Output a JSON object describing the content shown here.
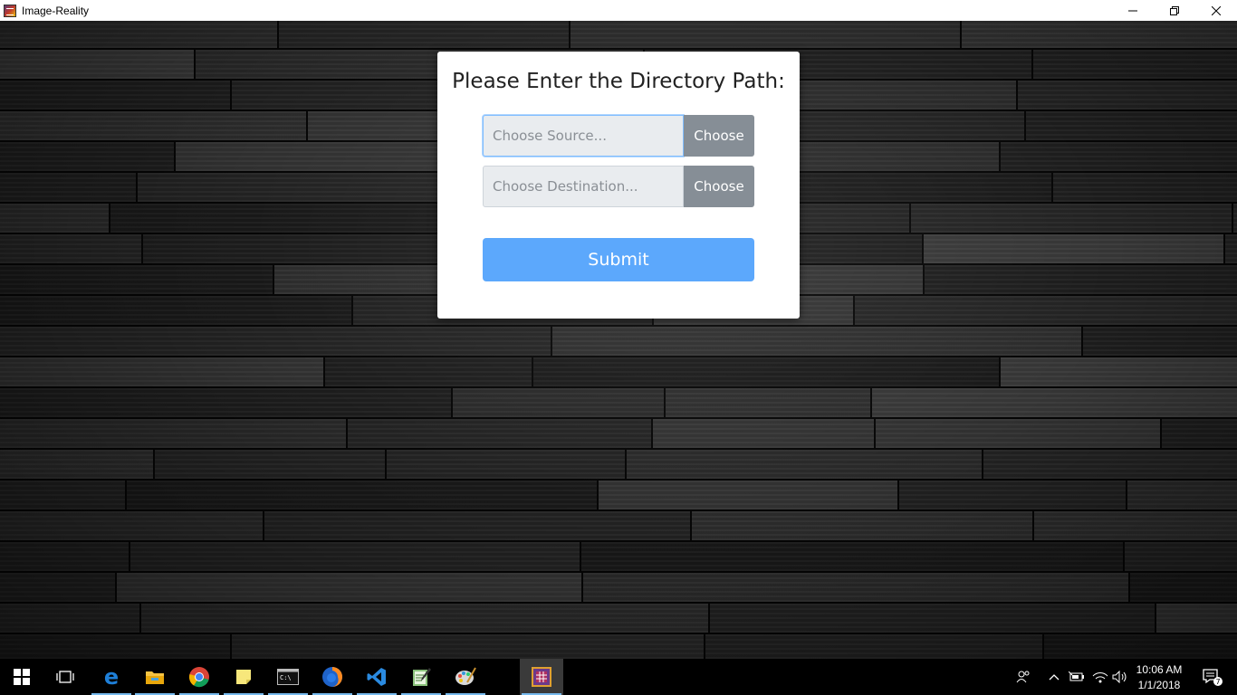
{
  "window": {
    "title": "Image-Reality",
    "controls": [
      "minimize",
      "restore",
      "close"
    ]
  },
  "dialog": {
    "heading": "Please Enter the Directory Path:",
    "source": {
      "placeholder": "Choose Source...",
      "value": "",
      "button_label": "Choose"
    },
    "destination": {
      "placeholder": "Choose Destination...",
      "value": "",
      "button_label": "Choose"
    },
    "submit_label": "Submit"
  },
  "taskbar": {
    "apps": [
      "start-icon",
      "task-view-icon",
      "edge-icon",
      "file-explorer-icon",
      "chrome-icon",
      "sticky-notes-icon",
      "terminal-icon",
      "firefox-icon",
      "vscode-icon",
      "notepad-icon",
      "paint-icon",
      "image-reality-icon"
    ],
    "tray_icons": [
      "people-icon",
      "chevron-up-icon",
      "battery-icon",
      "wifi-icon",
      "volume-icon"
    ],
    "time": "10:06 AM",
    "date": "1/1/2018",
    "notification_count": "7"
  },
  "colors": {
    "submit": "#5ca8fc",
    "choose": "#868e96",
    "taskbar": "#000000"
  }
}
